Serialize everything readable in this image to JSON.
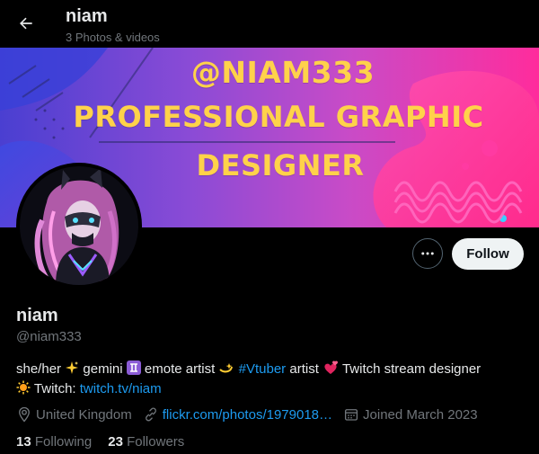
{
  "header": {
    "title": "niam",
    "subtitle": "3 Photos & videos"
  },
  "banner": {
    "line1": "@NIAM333",
    "line2": "PROFESSIONAL GRAPHIC",
    "line3": "DESIGNER"
  },
  "actions": {
    "follow_label": "Follow"
  },
  "profile": {
    "name": "niam",
    "handle": "@niam333",
    "bio": {
      "part1": "she/her",
      "part2": "gemini",
      "part3": "emote artist",
      "hashtag": "#Vtuber",
      "part4": "artist",
      "part5": "Twitch stream designer",
      "part6": "Twitch:",
      "twitch_link": "twitch.tv/niam"
    },
    "location": "United Kingdom",
    "website": "flickr.com/photos/1979018…",
    "joined": "Joined March 2023"
  },
  "stats": {
    "following_count": "13",
    "following_label": "Following",
    "followers_count": "23",
    "followers_label": "Followers"
  },
  "colors": {
    "accent_link": "#1d9bf0",
    "banner_text": "#ffd24a",
    "background": "#000000"
  }
}
